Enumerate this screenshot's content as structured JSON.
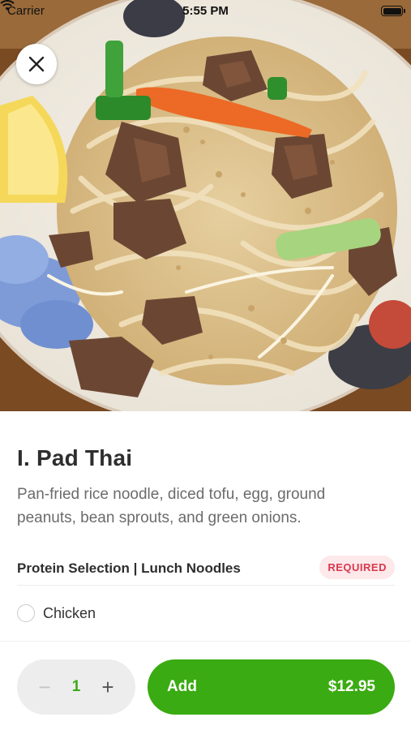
{
  "status_bar": {
    "carrier": "Carrier",
    "time": "5:55 PM",
    "wifi_icon": "wifi-icon",
    "battery_icon": "battery-icon"
  },
  "hero": {
    "image": "pad-thai-photo",
    "close_icon": "close-icon"
  },
  "item": {
    "title": "I. Pad Thai",
    "description": "Pan-fried rice noodle, diced tofu, egg, ground peanuts, bean sprouts, and green onions."
  },
  "options_section": {
    "title": "Protein Selection | Lunch Noodles",
    "badge": "REQUIRED",
    "options": [
      {
        "label": "Chicken",
        "selected": false
      }
    ]
  },
  "cart": {
    "minus_symbol": "−",
    "quantity": "1",
    "plus_symbol": "+",
    "add_label": "Add",
    "price": "$12.95"
  },
  "colors": {
    "accent_green": "#3aab12",
    "required_text": "#d8394c",
    "required_bg": "#fde8ea",
    "stepper_bg": "#ededed"
  }
}
